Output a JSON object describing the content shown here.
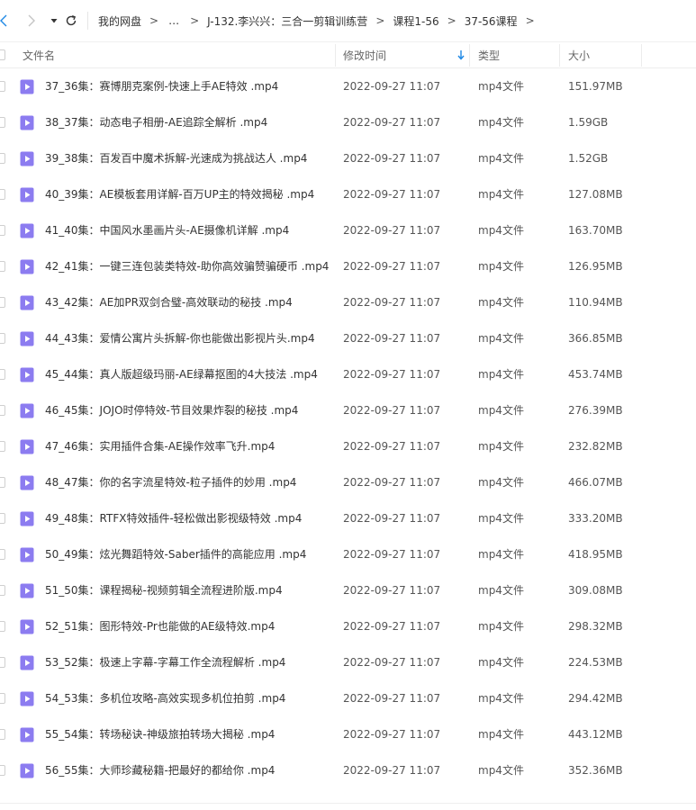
{
  "breadcrumb": {
    "items": [
      "我的网盘",
      "…",
      "J-132.李兴兴：三合一剪辑训练营",
      "课程1-56",
      "37-56课程"
    ],
    "separator": ">"
  },
  "header": {
    "name": "文件名",
    "modified": "修改时间",
    "type": "类型",
    "size": "大小"
  },
  "colors": {
    "accent": "#1e88e5",
    "file_icon": "#8c7cf0"
  },
  "files": [
    {
      "name": "37_36集：赛博朋克案例-快速上手AE特效 .mp4",
      "date": "2022-09-27 11:07",
      "type": "mp4文件",
      "size": "151.97MB"
    },
    {
      "name": "38_37集：动态电子相册-AE追踪全解析 .mp4",
      "date": "2022-09-27 11:07",
      "type": "mp4文件",
      "size": "1.59GB"
    },
    {
      "name": "39_38集：百发百中魔术拆解-光速成为挑战达人 .mp4",
      "date": "2022-09-27 11:07",
      "type": "mp4文件",
      "size": "1.52GB"
    },
    {
      "name": "40_39集：AE模板套用详解-百万UP主的特效揭秘 .mp4",
      "date": "2022-09-27 11:07",
      "type": "mp4文件",
      "size": "127.08MB"
    },
    {
      "name": "41_40集：中国风水墨画片头-AE摄像机详解 .mp4",
      "date": "2022-09-27 11:07",
      "type": "mp4文件",
      "size": "163.70MB"
    },
    {
      "name": "42_41集：一键三连包装类特效-助你高效骗赞骗硬币 .mp4",
      "date": "2022-09-27 11:07",
      "type": "mp4文件",
      "size": "126.95MB"
    },
    {
      "name": "43_42集：AE加PR双剑合璧-高效联动的秘技 .mp4",
      "date": "2022-09-27 11:07",
      "type": "mp4文件",
      "size": "110.94MB"
    },
    {
      "name": "44_43集：爱情公寓片头拆解-你也能做出影视片头.mp4",
      "date": "2022-09-27 11:07",
      "type": "mp4文件",
      "size": "366.85MB"
    },
    {
      "name": "45_44集：真人版超级玛丽-AE绿幕抠图的4大技法 .mp4",
      "date": "2022-09-27 11:07",
      "type": "mp4文件",
      "size": "453.74MB"
    },
    {
      "name": "46_45集：JOJO时停特效-节目效果炸裂的秘技 .mp4",
      "date": "2022-09-27 11:07",
      "type": "mp4文件",
      "size": "276.39MB"
    },
    {
      "name": "47_46集：实用插件合集-AE操作效率飞升.mp4",
      "date": "2022-09-27 11:07",
      "type": "mp4文件",
      "size": "232.82MB"
    },
    {
      "name": "48_47集：你的名字流星特效-粒子插件的妙用 .mp4",
      "date": "2022-09-27 11:07",
      "type": "mp4文件",
      "size": "466.07MB"
    },
    {
      "name": "49_48集：RTFX特效插件-轻松做出影视级特效 .mp4",
      "date": "2022-09-27 11:07",
      "type": "mp4文件",
      "size": "333.20MB"
    },
    {
      "name": "50_49集：炫光舞蹈特效-Saber插件的高能应用 .mp4",
      "date": "2022-09-27 11:07",
      "type": "mp4文件",
      "size": "418.95MB"
    },
    {
      "name": "51_50集：课程揭秘-视频剪辑全流程进阶版.mp4",
      "date": "2022-09-27 11:07",
      "type": "mp4文件",
      "size": "309.08MB"
    },
    {
      "name": "52_51集：图形特效-Pr也能做的AE级特效.mp4",
      "date": "2022-09-27 11:07",
      "type": "mp4文件",
      "size": "298.32MB"
    },
    {
      "name": "53_52集：极速上字幕-字幕工作全流程解析 .mp4",
      "date": "2022-09-27 11:07",
      "type": "mp4文件",
      "size": "224.53MB"
    },
    {
      "name": "54_53集：多机位攻略-高效实现多机位拍剪 .mp4",
      "date": "2022-09-27 11:07",
      "type": "mp4文件",
      "size": "294.42MB"
    },
    {
      "name": "55_54集：转场秘诀-神级旅拍转场大揭秘 .mp4",
      "date": "2022-09-27 11:07",
      "type": "mp4文件",
      "size": "443.12MB"
    },
    {
      "name": "56_55集：大师珍藏秘籍-把最好的都给你 .mp4",
      "date": "2022-09-27 11:07",
      "type": "mp4文件",
      "size": "352.36MB"
    }
  ]
}
